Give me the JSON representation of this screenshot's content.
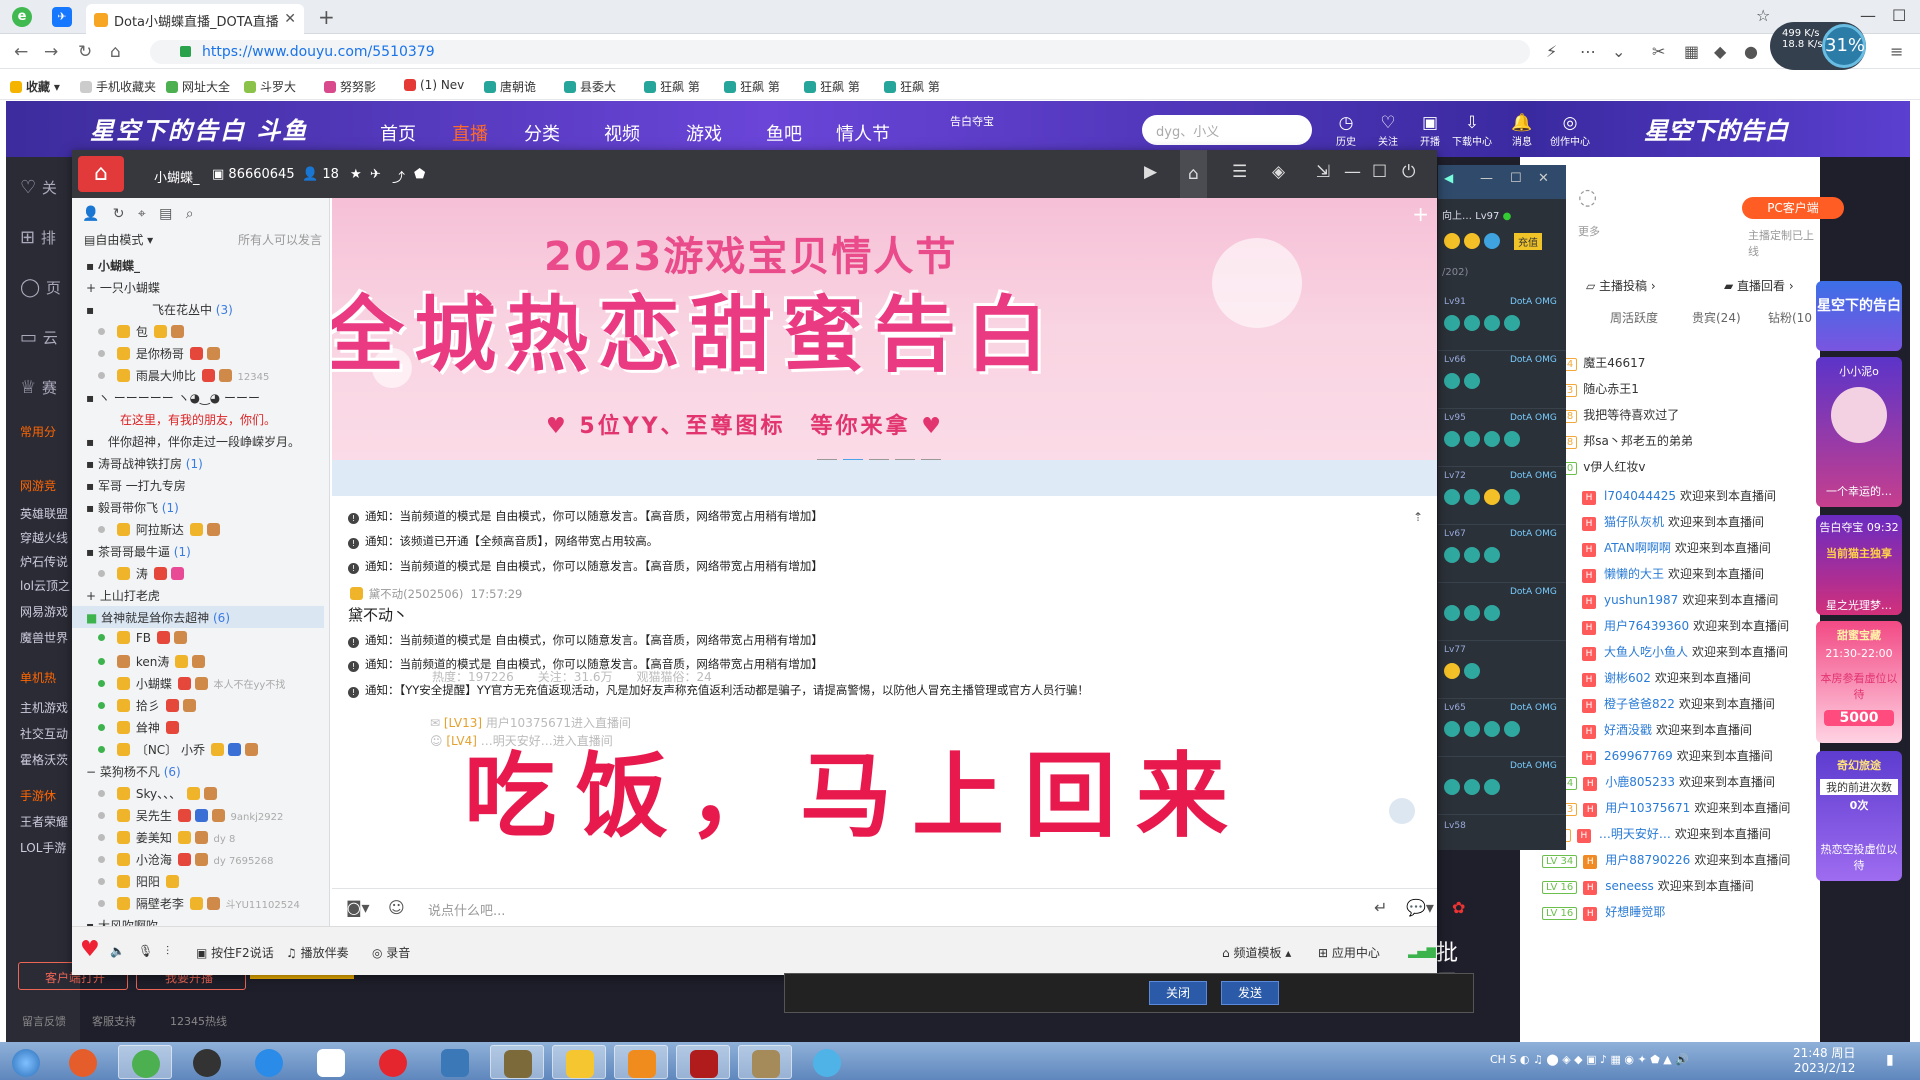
{
  "browser": {
    "tab_title": "Dota小蝴蝶直播_DOTA直播",
    "url": "https://www.douyu.com/5510379",
    "bookmarks": [
      "收藏",
      "手机收藏夹",
      "网址大全",
      "斗罗大",
      "努努影",
      "(1) Nev",
      "唐朝诡",
      "县委大",
      "狂飙 第",
      "狂飙 第",
      "狂飙 第",
      "狂飙 第"
    ],
    "speed_up": "499 K/s",
    "speed_down": "18.8 K/s",
    "cpu_percent": "31%"
  },
  "douyu": {
    "logo": "星空下的告白 斗鱼",
    "nav": [
      "首页",
      "直播",
      "分类",
      "视频",
      "游戏",
      "鱼吧",
      "情人节"
    ],
    "nav_active": "直播",
    "promo_top": "告白夺宝",
    "search_placeholder": "dyg、小义",
    "header_icons": [
      "历史",
      "关注",
      "开播",
      "下载中心",
      "消息",
      "创作中心"
    ],
    "header_banner": "星空下的告白",
    "left_menu": [
      "关",
      "排",
      "页",
      "云",
      "赛"
    ],
    "left_sections": [
      "常用分",
      "网游竞",
      "英雄联盟",
      "穿越火线",
      "炉石传说",
      "lol云顶之",
      "网易游戏",
      "魔兽世界",
      "单机热",
      "主机游戏",
      "社交互动",
      "霍格沃茨",
      "手游休",
      "王者荣耀",
      "LOL手游"
    ],
    "bottom_links": [
      "留言反馈",
      "客服支持",
      "12345热线"
    ],
    "client_open": "客户端打开",
    "start_live": "我要开播",
    "pc_client": "PC客户端",
    "host_reminder": "主播定制已上线",
    "more": "更多",
    "submit": "主播投稿",
    "replay": "直播回看",
    "rank_tabs": [
      "周活跃度",
      "贵宾(24)",
      "钻粉(10"
    ],
    "rank_top": [
      {
        "lv": "LV 34",
        "name": "魔王46617"
      },
      {
        "lv": "LV 33",
        "name": "随心赤王1"
      },
      {
        "lv": "LV 38",
        "name": "我把等待喜欢过了"
      },
      {
        "lv": "LV 28",
        "name": "邦sa丶邦老五的弟弟"
      },
      {
        "lv": "LV 30",
        "name": "v伊人红妆v"
      }
    ],
    "welcome_suffix": "欢迎来到本直播间",
    "welcome": [
      "l704044425",
      "猫仔队灰机",
      "ATAN啊啊啊",
      "懒懒的大王",
      "yushun1987",
      "用户76439360",
      "大鱼人吃小鱼人",
      "谢彬602",
      "橙子爸爸822",
      "好酒没戳",
      "269967769",
      "小鹿805233",
      "用户10375671",
      "…明天安好…",
      "用户88790226",
      "seneess",
      "好想睡觉耶"
    ],
    "welcome_lv": [
      "",
      "",
      "",
      "",
      "",
      "",
      "",
      "",
      "",
      "",
      "",
      "LV 14",
      "LV 13",
      "LV 4",
      "LV 34",
      "LV 16",
      "LV 16"
    ],
    "side_promos": [
      "星空下的告白",
      "小小泥o",
      "一个幸运的…",
      "告白夺宝 09:32",
      "当前猫主独享",
      "星之光理梦…",
      "甜蜜宝藏",
      "21:30-22:00",
      "本房参看虚位以待",
      "5000",
      "奇幻旅途",
      "我的前进次数",
      "0次",
      "热恋空投虚位以待"
    ]
  },
  "yy": {
    "channel_name": "小蝴蝶_",
    "channel_id": "86660645",
    "online_count": "18",
    "mode": "自由模式",
    "mode_right": "所有人可以发言",
    "tree": [
      {
        "t": "小蝴蝶_",
        "k": "root"
      },
      {
        "t": "一只小蝴蝶",
        "k": "group"
      },
      {
        "t": "飞在花丛中",
        "k": "sub",
        "c": "(3)"
      },
      {
        "t": "包",
        "k": "user"
      },
      {
        "t": "是你杨哥",
        "k": "user"
      },
      {
        "t": "雨晨大帅比",
        "k": "user",
        "x": "12345"
      },
      {
        "t": "ヽ ーーーーー ヽ◕‿◕ ーーー",
        "k": "group"
      },
      {
        "t": "在这里，有我的朋友，你们。",
        "k": "red"
      },
      {
        "t": "伴你超神，伴你走过一段峥嵘岁月。",
        "k": "group"
      },
      {
        "t": "涛哥战神铁打房",
        "k": "group",
        "c": "(1)"
      },
      {
        "t": "军哥 一打九专房",
        "k": "group"
      },
      {
        "t": "毅哥带你飞",
        "k": "group",
        "c": "(1)"
      },
      {
        "t": "阿拉斯达",
        "k": "user"
      },
      {
        "t": "茶哥哥最牛逼",
        "k": "group",
        "c": "(1)"
      },
      {
        "t": "涛",
        "k": "user"
      },
      {
        "t": "上山打老虎",
        "k": "group"
      },
      {
        "t": "耸神就是耸你去超神",
        "k": "sel",
        "c": "(6)"
      },
      {
        "t": "FB",
        "k": "online"
      },
      {
        "t": "ken涛",
        "k": "online"
      },
      {
        "t": "小蝴蝶",
        "k": "online",
        "x": "本人不在yy不找"
      },
      {
        "t": "拾彡",
        "k": "online"
      },
      {
        "t": "耸神",
        "k": "online"
      },
      {
        "t": "〔NC〕 小乔",
        "k": "online"
      },
      {
        "t": "菜狗杨不凡",
        "k": "group",
        "c": "(6)"
      },
      {
        "t": "Sky、、、",
        "k": "user"
      },
      {
        "t": "吴先生",
        "k": "user",
        "x": "9ankj2922"
      },
      {
        "t": "姜美知",
        "k": "user",
        "x": "dy 8"
      },
      {
        "t": "小沧海",
        "k": "user",
        "x": "dy 7695268"
      },
      {
        "t": "阳阳",
        "k": "user"
      },
      {
        "t": "隔壁老李",
        "k": "user",
        "x": "斗YU11102524"
      },
      {
        "t": "大风吹啊吹",
        "k": "group"
      }
    ],
    "banner_title": "2023游戏宝贝情人节",
    "banner_main": "全城热恋甜蜜告白",
    "banner_sub": "♥ 5位YY、至尊图标　等你来拿 ♥",
    "messages": [
      "通知：当前频道的模式是 自由模式，你可以随意发言。【高音质，网络带宽占用稍有增加】",
      "通知：该频道已开通【全频高音质】，网络带宽占用较高。",
      "通知：当前频道的模式是 自由模式，你可以随意发言。【高音质，网络带宽占用稍有增加】"
    ],
    "chat_user": "黛不动(2502506)",
    "chat_time": "17:57:29",
    "chat_text": "黛不动丶",
    "messages2": [
      "通知：当前频道的模式是 自由模式，你可以随意发言。【高音质，网络带宽占用稍有增加】",
      "通知：当前频道的模式是 自由模式，你可以随意发言。【高音质，网络带宽占用稍有增加】",
      "通知：【YY安全提醒】YY官方无充值返现活动，凡是加好友声称充值返利活动都是骗子，请提高警惕，以防他人冒充主播管理或官方人员行骗！"
    ],
    "ghost_stats": "热度：197226　　关注：31.6万　　观猫猫俗：24",
    "ghost_rows": [
      {
        "lv": "[LV13]",
        "text": "用户10375671进入直播间"
      },
      {
        "lv": "[LV4]",
        "text": "…明天安好…进入直播间"
      }
    ],
    "afk_text": "吃饭，马上回来",
    "input_placeholder": "说点什么吧...",
    "bottom": [
      "按住F2说话",
      "播放伴奏",
      "录音",
      "频道模板",
      "应用中心"
    ]
  },
  "overlay": {
    "mini_user": "向上…",
    "mini_lv": "Lv97",
    "mini_recharge": "充值",
    "mini_count": "/202)",
    "mini_levels": [
      "Lv91",
      "Lv66",
      "Lv95",
      "Lv72",
      "Lv67",
      "Lv77",
      "Lv65",
      "Lv58"
    ],
    "mini_tag": "DotA OMG",
    "dlg_close": "关闭",
    "dlg_send": "发送",
    "dlg_side": "批 示"
  },
  "taskbar": {
    "clock_time": "21:48 周日",
    "clock_date": "2023/2/12",
    "tray_lang": "CH"
  }
}
